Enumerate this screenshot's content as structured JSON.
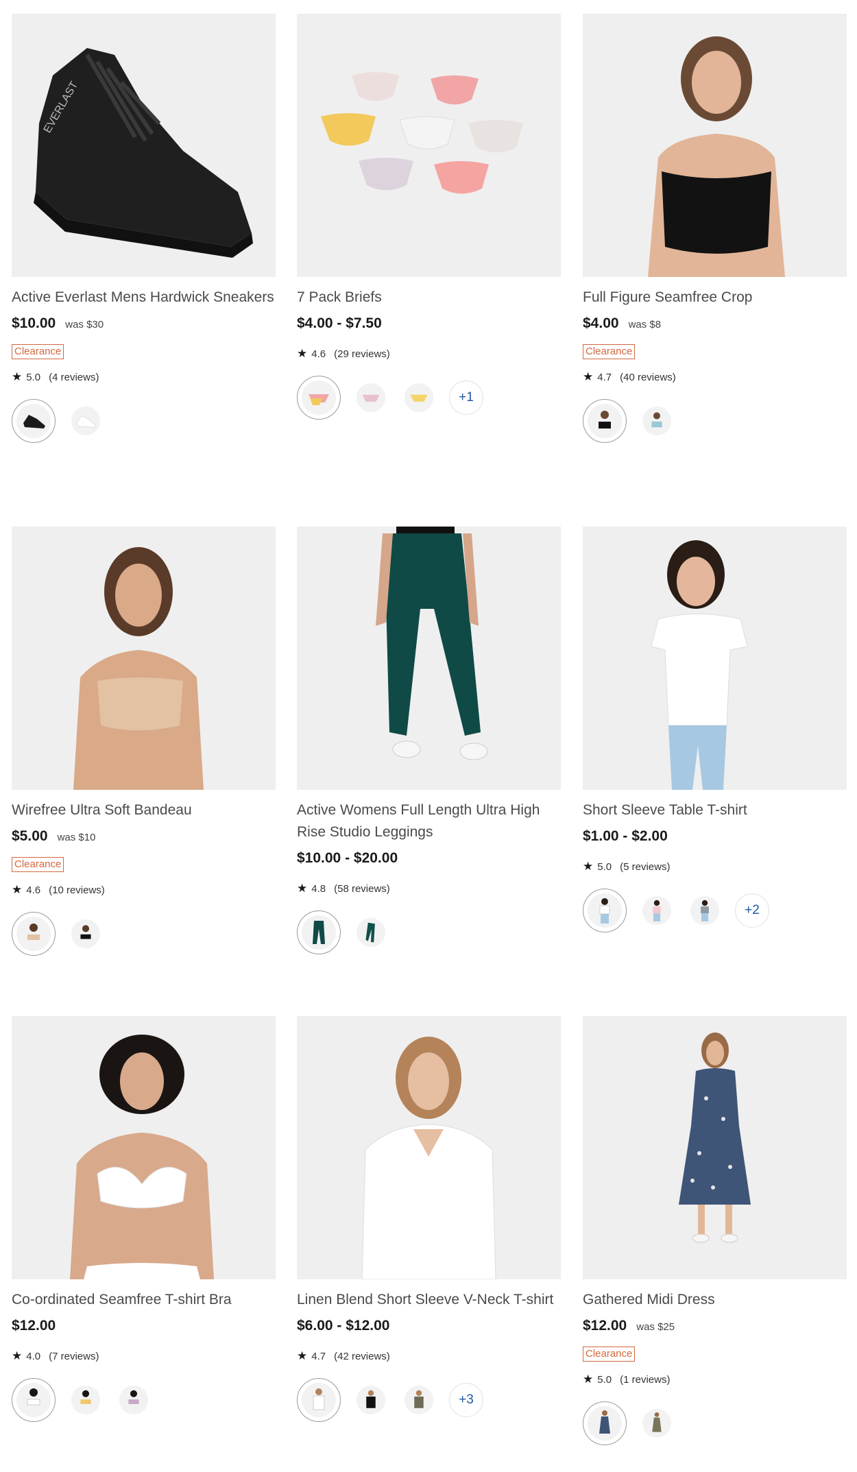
{
  "products": [
    {
      "title": "Active Everlast Mens Hardwick Sneakers",
      "price": "$10.00",
      "was": "was $30",
      "badge": "Clearance",
      "rating": "5.0",
      "reviews": "(4 reviews)",
      "image": "black-sneaker",
      "swatches": [
        "black",
        "white"
      ],
      "more": ""
    },
    {
      "title": "7 Pack Briefs",
      "price": "$4.00 - $7.50",
      "was": "",
      "badge": "",
      "rating": "4.6",
      "reviews": "(29 reviews)",
      "image": "briefs-pack",
      "swatches": [
        "multi-pastel",
        "multi-pink",
        "multi-yellow"
      ],
      "more": "+1"
    },
    {
      "title": "Full Figure Seamfree Crop",
      "price": "$4.00",
      "was": "was $8",
      "badge": "Clearance",
      "rating": "4.7",
      "reviews": "(40 reviews)",
      "image": "model-black-crop",
      "swatches": [
        "black",
        "blue"
      ],
      "more": ""
    },
    {
      "title": "Wirefree Ultra Soft Bandeau",
      "price": "$5.00",
      "was": "was $10",
      "badge": "Clearance",
      "rating": "4.6",
      "reviews": "(10 reviews)",
      "image": "model-nude-bandeau",
      "swatches": [
        "nude",
        "black"
      ],
      "more": ""
    },
    {
      "title": "Active Womens Full Length Ultra High Rise Studio Leggings",
      "price": "$10.00 - $20.00",
      "was": "",
      "badge": "",
      "rating": "4.8",
      "reviews": "(58 reviews)",
      "image": "green-leggings",
      "swatches": [
        "green",
        "green-alt"
      ],
      "more": ""
    },
    {
      "title": "Short Sleeve Table T-shirt",
      "price": "$1.00 - $2.00",
      "was": "",
      "badge": "",
      "rating": "5.0",
      "reviews": "(5 reviews)",
      "image": "girl-white-tee",
      "swatches": [
        "white",
        "pink",
        "grey"
      ],
      "more": "+2"
    },
    {
      "title": "Co-ordinated Seamfree T-shirt Bra",
      "price": "$12.00",
      "was": "",
      "badge": "",
      "rating": "4.0",
      "reviews": "(7 reviews)",
      "image": "model-white-bra",
      "swatches": [
        "white",
        "yellow",
        "lilac"
      ],
      "more": ""
    },
    {
      "title": "Linen Blend Short Sleeve V-Neck T-shirt",
      "price": "$6.00 - $12.00",
      "was": "",
      "badge": "",
      "rating": "4.7",
      "reviews": "(42 reviews)",
      "image": "model-white-vneck",
      "swatches": [
        "white",
        "black",
        "khaki"
      ],
      "more": "+3"
    },
    {
      "title": "Gathered Midi Dress",
      "price": "$12.00",
      "was": "was $25",
      "badge": "Clearance",
      "rating": "5.0",
      "reviews": "(1 reviews)",
      "image": "floral-midi-dress",
      "swatches": [
        "navy-floral",
        "khaki"
      ],
      "more": ""
    }
  ],
  "colors": {
    "clearance": "#d2683e",
    "more_link": "#2158a6",
    "title_text": "#4a4a4a"
  }
}
